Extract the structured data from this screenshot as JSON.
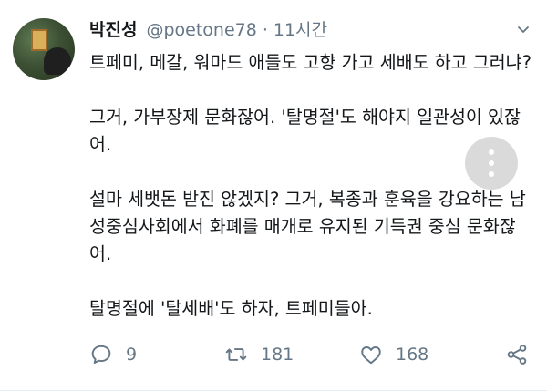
{
  "tweet": {
    "author": {
      "display_name": "박진성",
      "handle": "@poetone78"
    },
    "separator": "·",
    "time": "11시간",
    "paragraphs": [
      "트페미, 메갈, 워마드 애들도 고향 가고 세배도 하고 그러냐?",
      "그거, 가부장제 문화잖어. '탈명절'도 해야지 일관성이 있잖어.",
      "설마 세뱃돈 받진 않겠지? 그거, 복종과 훈육을 강요하는 남성중심사회에서 화폐를 매개로 유지된 기득권 중심 문화잖어.",
      "탈명절에 '탈세배'도 하자, 트페미들아."
    ],
    "actions": {
      "reply_count": "9",
      "retweet_count": "181",
      "like_count": "168"
    }
  },
  "icons": {
    "menu": "chevron-down-icon",
    "reply": "reply-icon",
    "retweet": "retweet-icon",
    "like": "heart-icon",
    "share": "share-icon",
    "overlay": "more-vertical-icon"
  },
  "colors": {
    "text": "#14171a",
    "secondary": "#657786",
    "overlay": "#d9d9d9"
  }
}
